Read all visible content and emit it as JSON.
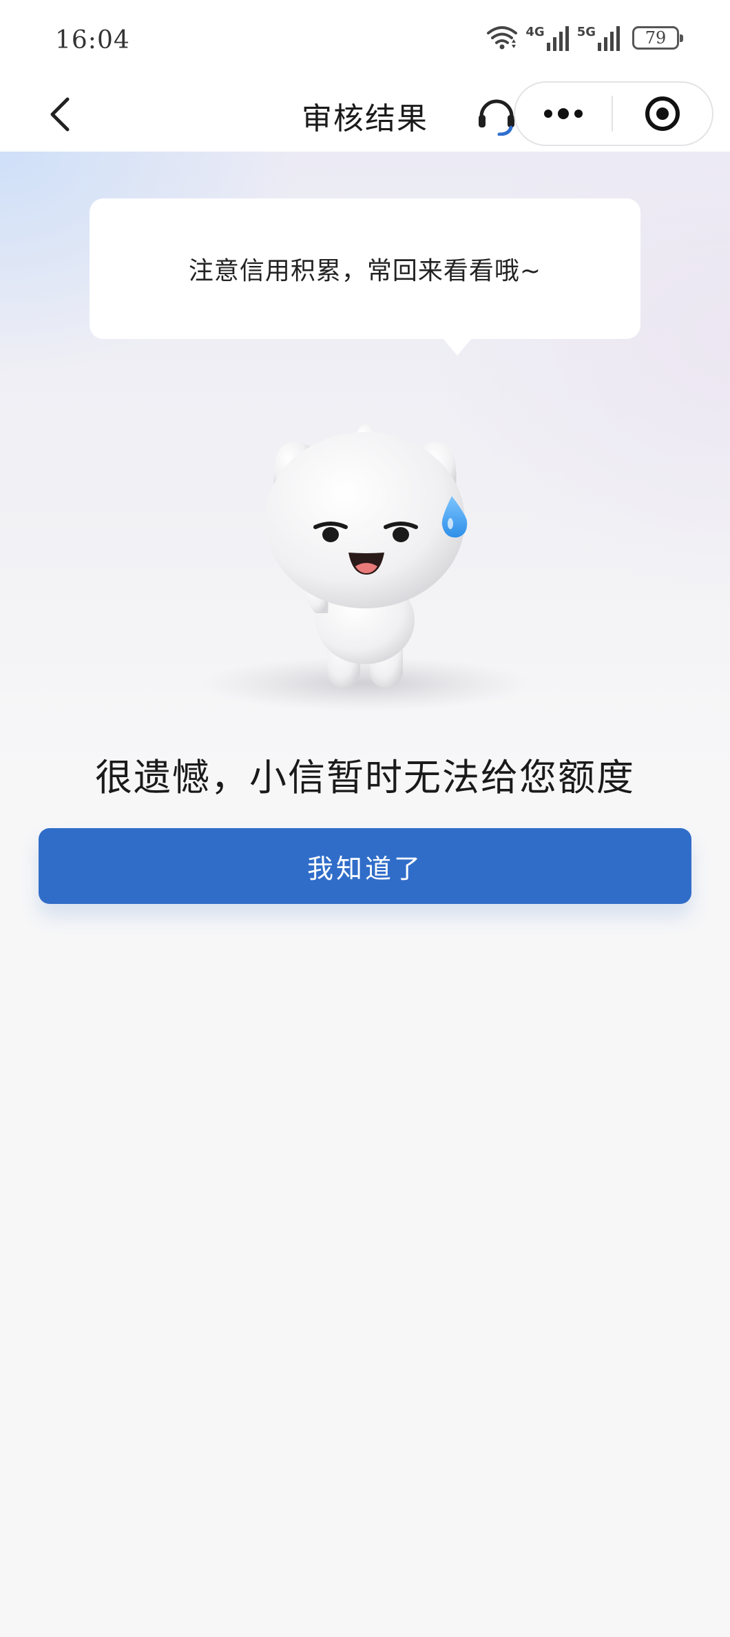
{
  "status_bar": {
    "time": "16:04",
    "network_1": "4G",
    "network_2": "5G",
    "battery": "79"
  },
  "nav": {
    "title": "审核结果"
  },
  "bubble": {
    "text": "注意信用积累，常回来看看哦~"
  },
  "result": {
    "message": "很遗憾，小信暂时无法给您额度"
  },
  "actions": {
    "confirm_label": "我知道了"
  },
  "colors": {
    "primary": "#306dc9",
    "headset_accent": "#2f6fd0",
    "sweat_drop": "#3a9ff0"
  }
}
